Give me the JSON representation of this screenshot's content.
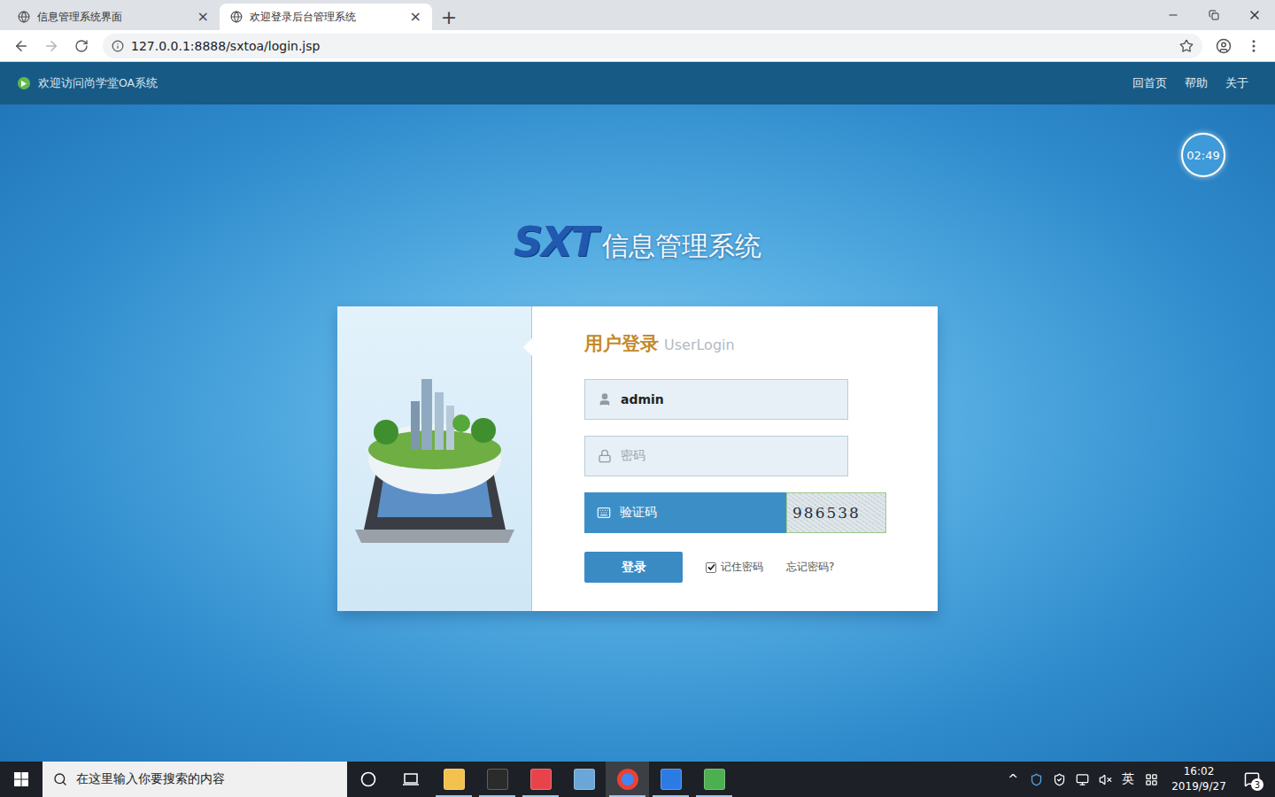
{
  "browser": {
    "tabs": [
      {
        "title": "信息管理系统界面",
        "selected": false,
        "close": "×"
      },
      {
        "title": "欢迎登录后台管理系统",
        "selected": true,
        "close": "×"
      }
    ],
    "new_tab": "+",
    "url": "127.0.0.1:8888/sxtoa/login.jsp"
  },
  "page": {
    "header": {
      "welcome": "欢迎访问尚学堂OA系统",
      "links": [
        "回首页",
        "帮助",
        "关于"
      ]
    },
    "clock": "02:49",
    "logo": {
      "mark": "SXT",
      "title": "信息管理系统"
    },
    "login": {
      "title": "用户登录",
      "subtitle": "UserLogin",
      "username": {
        "value": "admin"
      },
      "password": {
        "placeholder": "密码"
      },
      "captcha": {
        "placeholder": "验证码",
        "code": "986538"
      },
      "submit": "登录",
      "remember": {
        "label": "记住密码",
        "checked": true
      },
      "forgot": "忘记密码?"
    }
  },
  "taskbar": {
    "search_placeholder": "在这里输入你要搜索的内容",
    "apps": [
      {
        "name": "file-explorer",
        "kind": "square",
        "color": "#f2c14e",
        "running": true,
        "selected": false
      },
      {
        "name": "intellij",
        "kind": "square",
        "color": "#2b2b2b",
        "running": true,
        "selected": false
      },
      {
        "name": "xmind",
        "kind": "square",
        "color": "#e8434b",
        "running": true,
        "selected": false
      },
      {
        "name": "paint",
        "kind": "square",
        "color": "#6aa7d8",
        "running": false,
        "selected": false
      },
      {
        "name": "chrome",
        "kind": "circle",
        "color": "#4285f4",
        "running": true,
        "selected": true
      },
      {
        "name": "writer",
        "kind": "square",
        "color": "#2c7be5",
        "running": true,
        "selected": false
      },
      {
        "name": "chart-tool",
        "kind": "square",
        "color": "#4caf50",
        "running": true,
        "selected": false
      }
    ],
    "tray": {
      "expand": "^",
      "ime": "英",
      "time": "16:02",
      "date": "2019/9/27",
      "notifications": "3"
    }
  }
}
